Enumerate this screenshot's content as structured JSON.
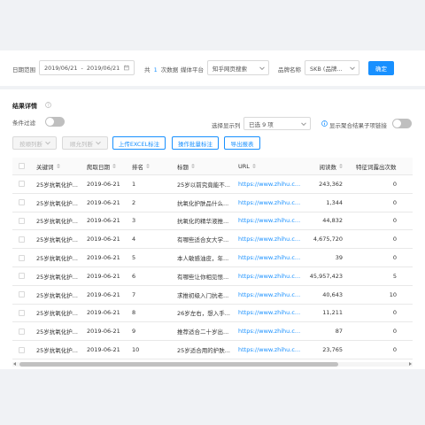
{
  "filter": {
    "date_label": "日期范围",
    "date_start": "2019/06/21",
    "date_sep": "-",
    "date_end": "2019/06/21",
    "count_prefix": "共",
    "count_value": "1",
    "count_suffix": "次数据",
    "media_label": "媒体平台",
    "media_value": "知乎网页搜索",
    "brand_label": "品牌名称",
    "brand_value": "SKB (品牌...",
    "confirm_label": "确定"
  },
  "results": {
    "title": "结果详情",
    "condition_label": "条件过滤",
    "select_display_label": "选择显示列",
    "select_display_value": "已选 9 项",
    "show_link_label": "显示聚合结果子项链接",
    "btn_sort_col": "按顺列断",
    "btn_sort_col2": "顺允列断",
    "btn_upload": "上传EXCEL标注",
    "btn_batch": "操作批量标注",
    "btn_export": "导出报表"
  },
  "table": {
    "headers": [
      "关键词",
      "爬取日期",
      "排名",
      "标题",
      "URL",
      "阅读数",
      "特征词露出次数"
    ],
    "rows": [
      {
        "kw": "25岁抗氧化护...",
        "date": "2019-06-21",
        "rank": "1",
        "title": "25岁以前究竟能不...",
        "url": "https://www.zhihu.c...",
        "reads": "243,362",
        "count": "0"
      },
      {
        "kw": "25岁抗氧化护...",
        "date": "2019-06-21",
        "rank": "2",
        "title": "抗氧化护肤品什么...",
        "url": "https://www.zhihu.c...",
        "reads": "1,344",
        "count": "0"
      },
      {
        "kw": "25岁抗氧化护...",
        "date": "2019-06-21",
        "rank": "3",
        "title": "抗氧化的精华液推...",
        "url": "https://www.zhihu.c...",
        "reads": "44,832",
        "count": "0"
      },
      {
        "kw": "25岁抗氧化护...",
        "date": "2019-06-21",
        "rank": "4",
        "title": "有哪些适合女大学...",
        "url": "https://www.zhihu.c...",
        "reads": "4,675,720",
        "count": "0"
      },
      {
        "kw": "25岁抗氧化护...",
        "date": "2019-06-21",
        "rank": "5",
        "title": "本人敏感油皮，年...",
        "url": "https://www.zhihu.c...",
        "reads": "39",
        "count": "0"
      },
      {
        "kw": "25岁抗氧化护...",
        "date": "2019-06-21",
        "rank": "6",
        "title": "有哪些让你相见恨...",
        "url": "https://www.zhihu.c...",
        "reads": "45,957,423",
        "count": "5"
      },
      {
        "kw": "25岁抗氧化护...",
        "date": "2019-06-21",
        "rank": "7",
        "title": "求推初级入门抗老...",
        "url": "https://www.zhihu.c...",
        "reads": "40,643",
        "count": "10"
      },
      {
        "kw": "25岁抗氧化护...",
        "date": "2019-06-21",
        "rank": "8",
        "title": "26岁左右，想入手...",
        "url": "https://www.zhihu.c...",
        "reads": "11,211",
        "count": "0"
      },
      {
        "kw": "25岁抗氧化护...",
        "date": "2019-06-21",
        "rank": "9",
        "title": "推荐适合二十岁出...",
        "url": "https://www.zhihu.c...",
        "reads": "87",
        "count": "0"
      },
      {
        "kw": "25岁抗氧化护...",
        "date": "2019-06-21",
        "rank": "10",
        "title": "25岁适合用的护肤...",
        "url": "https://www.zhihu.c...",
        "reads": "23,765",
        "count": "0"
      }
    ]
  }
}
